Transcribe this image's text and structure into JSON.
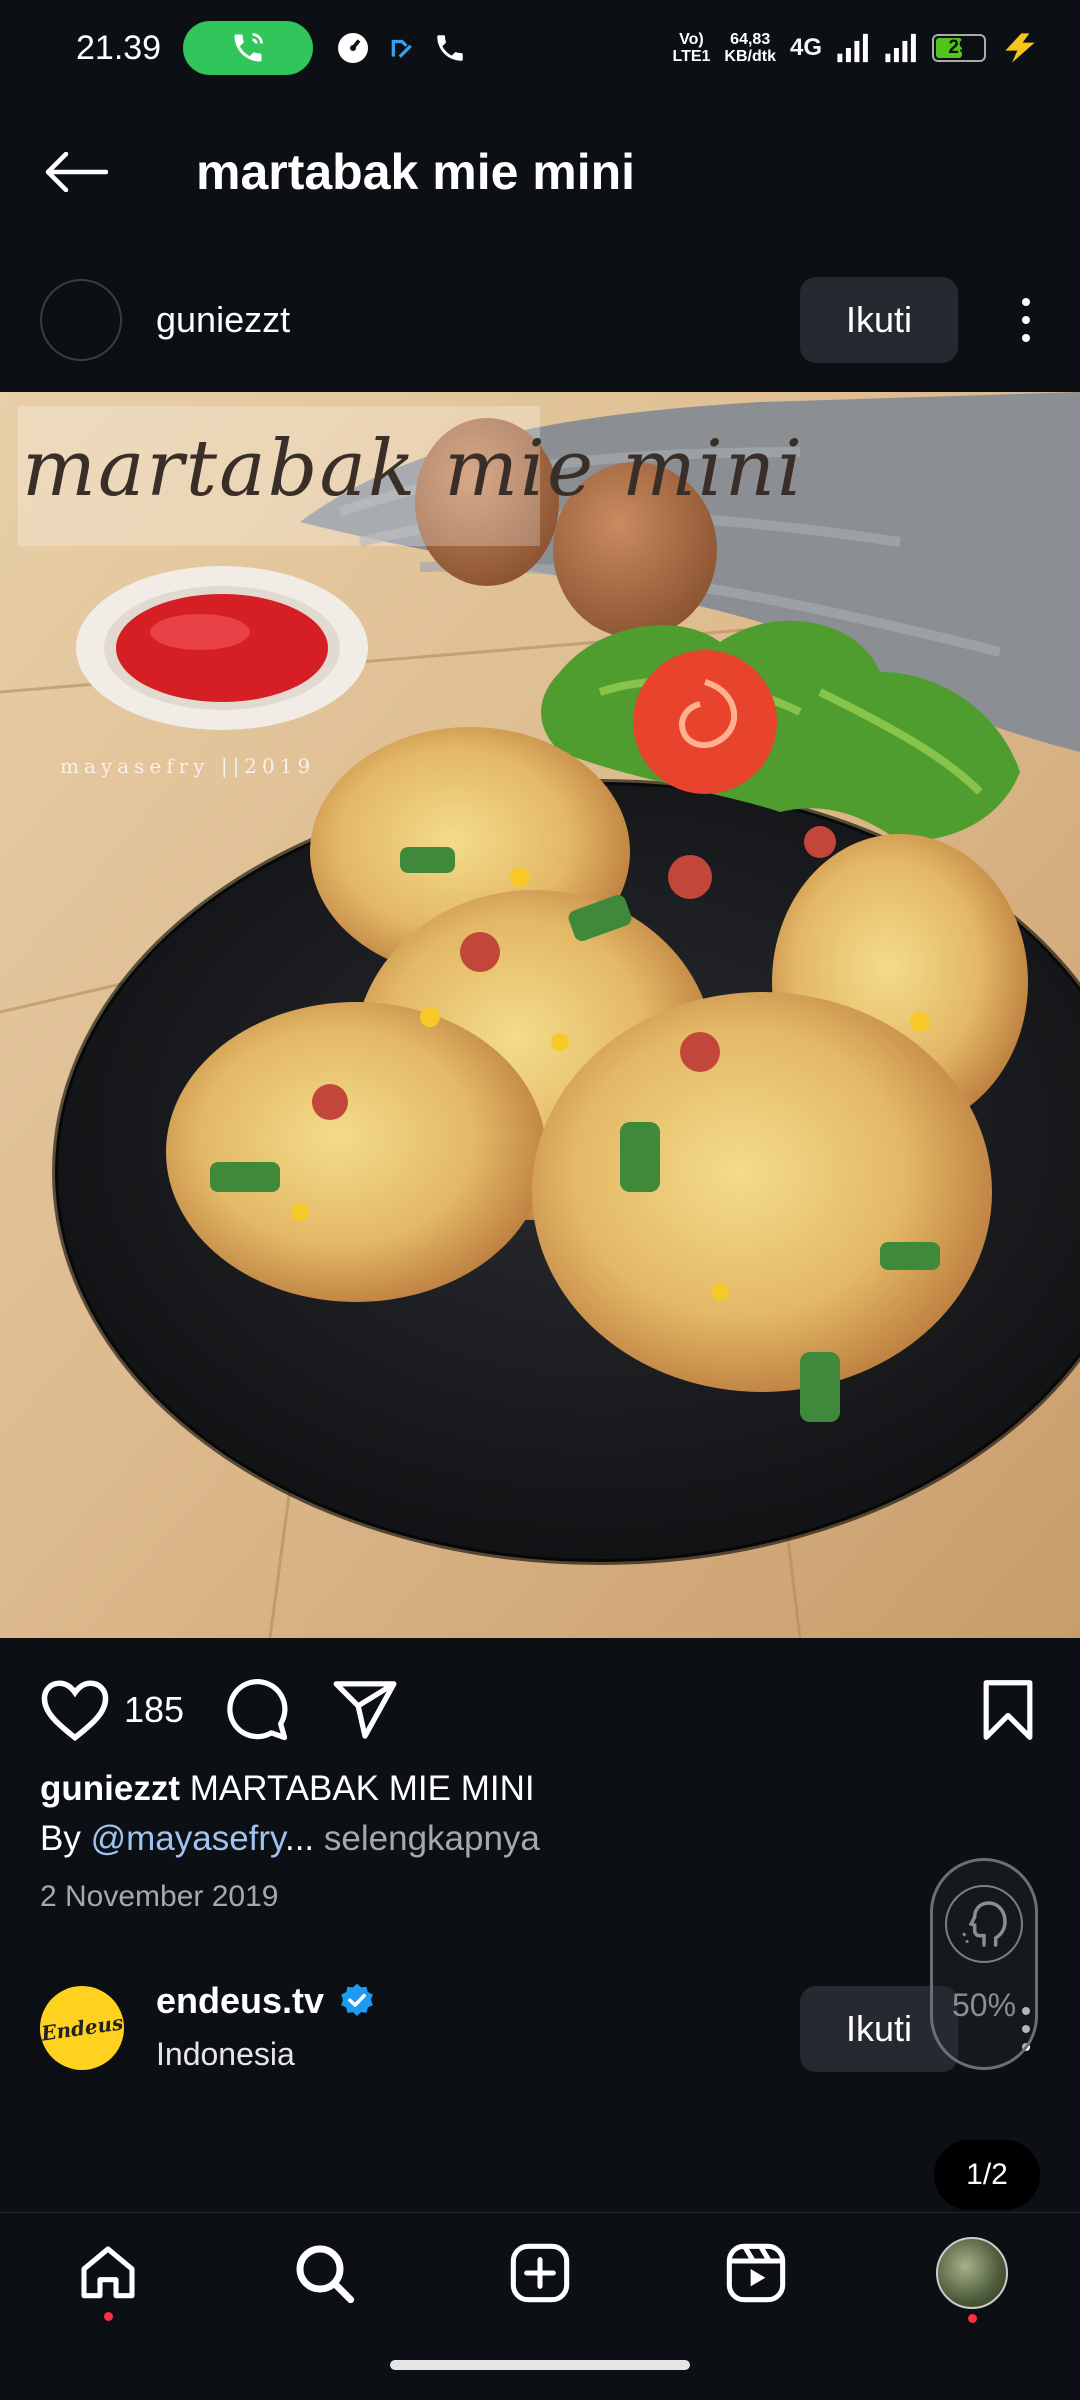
{
  "status_bar": {
    "time": "21.39",
    "network_type_top": "Vo)",
    "network_type_bottom": "LTE1",
    "speed_value": "64,83",
    "speed_unit": "KB/dtk",
    "cell_label": "4G",
    "battery_level": "29",
    "icons": [
      "phone-call-icon",
      "speedometer-icon",
      "app-icon",
      "phone-icon",
      "signal-icon",
      "battery-icon",
      "charging-icon"
    ]
  },
  "header": {
    "title": "martabak mie mini"
  },
  "post": {
    "username": "guniezzt",
    "follow_label": "Ikuti",
    "image_overlay_title": "martabak mie mini",
    "image_watermark": "mayasefry ||2019",
    "like_count": "185",
    "caption_username": "guniezzt",
    "caption_text": "MARTABAK MIE MINI",
    "caption_by": "By",
    "caption_mention": "@mayasefry",
    "caption_ellipsis": "...",
    "caption_more": "selengkapnya",
    "date": "2 November 2019"
  },
  "suggested": {
    "name": "endeus.tv",
    "subtitle": "Indonesia",
    "logo_text": "Endeus",
    "follow_label": "Ikuti"
  },
  "floating_widget": {
    "percent": "50%"
  },
  "page_indicator": "1/2",
  "colors": {
    "background": "#0c1014",
    "button_bg": "#262a30",
    "mention": "#9ec3f0",
    "verified": "#1d9bf0",
    "call_pill": "#31c65b",
    "notification_dot": "#ff3040"
  }
}
